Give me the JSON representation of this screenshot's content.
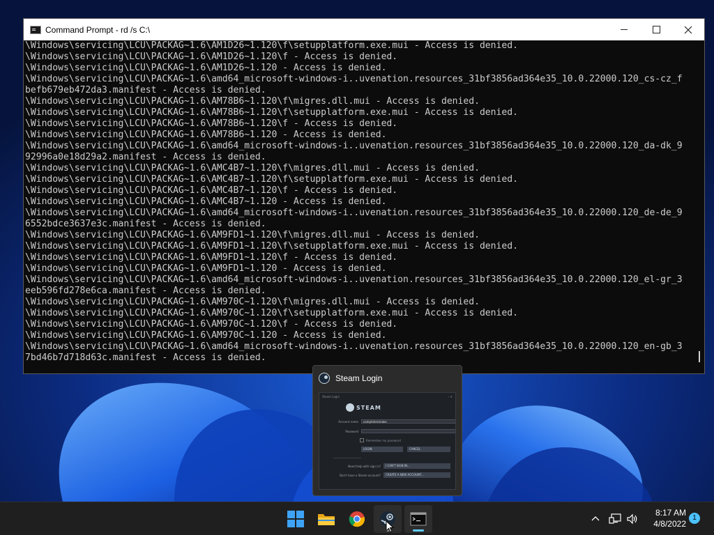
{
  "cmd": {
    "title": "Command Prompt - rd  /s C:\\",
    "lines": [
      "\\Windows\\servicing\\LCU\\PACKAG~1.6\\AM1D26~1.120\\f\\setupplatform.exe.mui - Access is denied.",
      "\\Windows\\servicing\\LCU\\PACKAG~1.6\\AM1D26~1.120\\f - Access is denied.",
      "\\Windows\\servicing\\LCU\\PACKAG~1.6\\AM1D26~1.120 - Access is denied.",
      "\\Windows\\servicing\\LCU\\PACKAG~1.6\\amd64_microsoft-windows-i..uvenation.resources_31bf3856ad364e35_10.0.22000.120_cs-cz_f",
      "befb679eb472da3.manifest - Access is denied.",
      "\\Windows\\servicing\\LCU\\PACKAG~1.6\\AM78B6~1.120\\f\\migres.dll.mui - Access is denied.",
      "\\Windows\\servicing\\LCU\\PACKAG~1.6\\AM78B6~1.120\\f\\setupplatform.exe.mui - Access is denied.",
      "\\Windows\\servicing\\LCU\\PACKAG~1.6\\AM78B6~1.120\\f - Access is denied.",
      "\\Windows\\servicing\\LCU\\PACKAG~1.6\\AM78B6~1.120 - Access is denied.",
      "\\Windows\\servicing\\LCU\\PACKAG~1.6\\amd64_microsoft-windows-i..uvenation.resources_31bf3856ad364e35_10.0.22000.120_da-dk_9",
      "92996a0e18d29a2.manifest - Access is denied.",
      "\\Windows\\servicing\\LCU\\PACKAG~1.6\\AMC4B7~1.120\\f\\migres.dll.mui - Access is denied.",
      "\\Windows\\servicing\\LCU\\PACKAG~1.6\\AMC4B7~1.120\\f\\setupplatform.exe.mui - Access is denied.",
      "\\Windows\\servicing\\LCU\\PACKAG~1.6\\AMC4B7~1.120\\f - Access is denied.",
      "\\Windows\\servicing\\LCU\\PACKAG~1.6\\AMC4B7~1.120 - Access is denied.",
      "\\Windows\\servicing\\LCU\\PACKAG~1.6\\amd64_microsoft-windows-i..uvenation.resources_31bf3856ad364e35_10.0.22000.120_de-de_9",
      "6552bdce3637e3c.manifest - Access is denied.",
      "\\Windows\\servicing\\LCU\\PACKAG~1.6\\AM9FD1~1.120\\f\\migres.dll.mui - Access is denied.",
      "\\Windows\\servicing\\LCU\\PACKAG~1.6\\AM9FD1~1.120\\f\\setupplatform.exe.mui - Access is denied.",
      "\\Windows\\servicing\\LCU\\PACKAG~1.6\\AM9FD1~1.120\\f - Access is denied.",
      "\\Windows\\servicing\\LCU\\PACKAG~1.6\\AM9FD1~1.120 - Access is denied.",
      "\\Windows\\servicing\\LCU\\PACKAG~1.6\\amd64_microsoft-windows-i..uvenation.resources_31bf3856ad364e35_10.0.22000.120_el-gr_3",
      "eeb596fd278e6ca.manifest - Access is denied.",
      "\\Windows\\servicing\\LCU\\PACKAG~1.6\\AM970C~1.120\\f\\migres.dll.mui - Access is denied.",
      "\\Windows\\servicing\\LCU\\PACKAG~1.6\\AM970C~1.120\\f\\setupplatform.exe.mui - Access is denied.",
      "\\Windows\\servicing\\LCU\\PACKAG~1.6\\AM970C~1.120\\f - Access is denied.",
      "\\Windows\\servicing\\LCU\\PACKAG~1.6\\AM970C~1.120 - Access is denied.",
      "\\Windows\\servicing\\LCU\\PACKAG~1.6\\amd64_microsoft-windows-i..uvenation.resources_31bf3856ad364e35_10.0.22000.120_en-gb_3",
      "7bd46b7d718d63c.manifest - Access is denied."
    ]
  },
  "preview": {
    "title": "Steam Login",
    "thumb": {
      "window_title": "Steam Login",
      "brand": "STEAM",
      "account_label": "Account name",
      "account_value": "completeremake",
      "password_label": "Password",
      "remember_label": "Remember my password",
      "login_button": "LOGIN",
      "cancel_button": "CANCEL",
      "help_label": "Need help with sign in?",
      "help_button": "I CAN'T SIGN IN...",
      "create_label": "Don't have a Steam account?",
      "create_button": "CREATE A NEW ACCOUNT..."
    }
  },
  "taskbar": {
    "apps": [
      "start",
      "file-explorer",
      "chrome",
      "steam",
      "command-prompt"
    ],
    "time": "8:17 AM",
    "date": "4/8/2022",
    "notification_count": "1",
    "accent_color": "#60cdff"
  }
}
